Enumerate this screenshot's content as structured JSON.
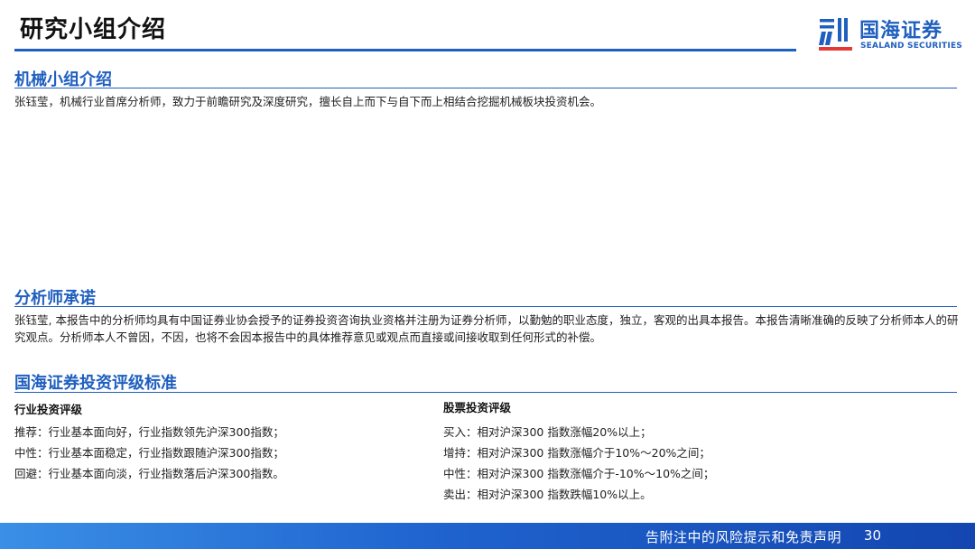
{
  "header": {
    "title": "研究小组介绍",
    "logo": {
      "cn": "国海证券",
      "en": "SEALAND SECURITIES"
    },
    "accent_color": "#1f5fbf"
  },
  "team": {
    "heading": "机械小组介绍",
    "text": "张钰莹，机械行业首席分析师，致力于前瞻研究及深度研究，擅长自上而下与自下而上相结合挖掘机械板块投资机会。"
  },
  "commitment": {
    "heading": "分析师承诺",
    "text": "张钰莹, 本报告中的分析师均具有中国证券业协会授予的证券投资咨询执业资格并注册为证券分析师，以勤勉的职业态度，独立，客观的出具本报告。本报告清晰准确的反映了分析师本人的研究观点。分析师本人不曾因，不因，也将不会因本报告中的具体推荐意见或观点而直接或间接收取到任何形式的补偿。"
  },
  "rating": {
    "heading": "国海证券投资评级标准",
    "industry": {
      "title": "行业投资评级",
      "items": [
        "推荐：行业基本面向好，行业指数领先沪深300指数；",
        "中性：行业基本面稳定，行业指数跟随沪深300指数；",
        "回避：行业基本面向淡，行业指数落后沪深300指数。"
      ]
    },
    "stock": {
      "title": "股票投资评级",
      "items": [
        "买入：相对沪深300 指数涨幅20%以上；",
        "增持：相对沪深300 指数涨幅介于10%～20%之间；",
        "中性：相对沪深300 指数涨幅介于-10%～10%之间；",
        "卖出：相对沪深300 指数跌幅10%以上。"
      ]
    }
  },
  "footer": {
    "text": "告附注中的风险提示和免责声明",
    "page": "30"
  }
}
